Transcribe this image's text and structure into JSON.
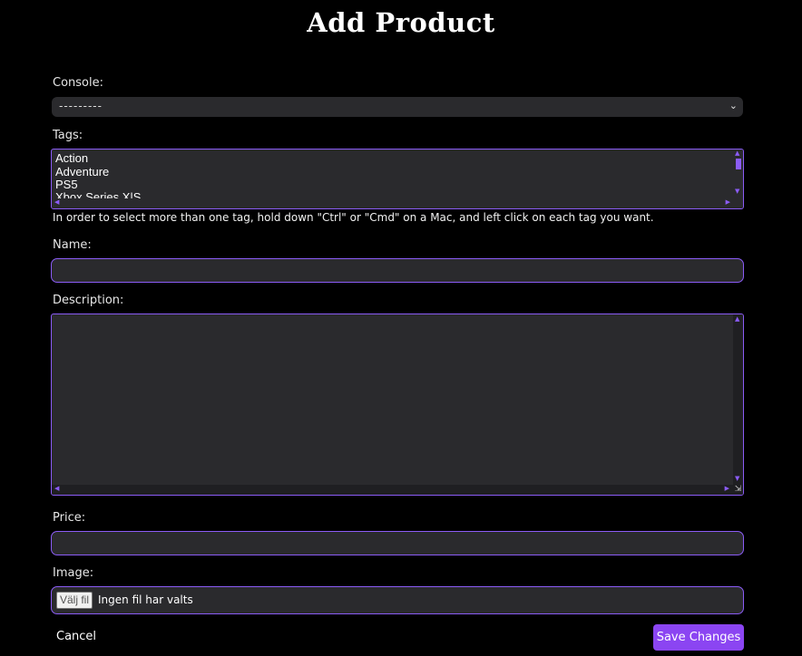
{
  "page": {
    "title": "Add Product"
  },
  "form": {
    "console": {
      "label": "Console:",
      "selected": "---------"
    },
    "tags": {
      "label": "Tags:",
      "options": [
        "Action",
        "Adventure",
        "PS5",
        "Xbox Series X|S"
      ],
      "hint": "In order to select more than one tag, hold down \"Ctrl\" or \"Cmd\" on a Mac, and left click on each tag you want."
    },
    "name": {
      "label": "Name:",
      "value": ""
    },
    "description": {
      "label": "Description:",
      "value": ""
    },
    "price": {
      "label": "Price:",
      "value": ""
    },
    "image": {
      "label": "Image:",
      "button": "Välj fil",
      "status": "Ingen fil har valts"
    }
  },
  "actions": {
    "cancel": "Cancel",
    "save": "Save Changes"
  },
  "colors": {
    "accent": "#8b5cf6",
    "button": "#8b45f2",
    "field_bg": "#2a2a2d",
    "page_bg": "#000000"
  }
}
